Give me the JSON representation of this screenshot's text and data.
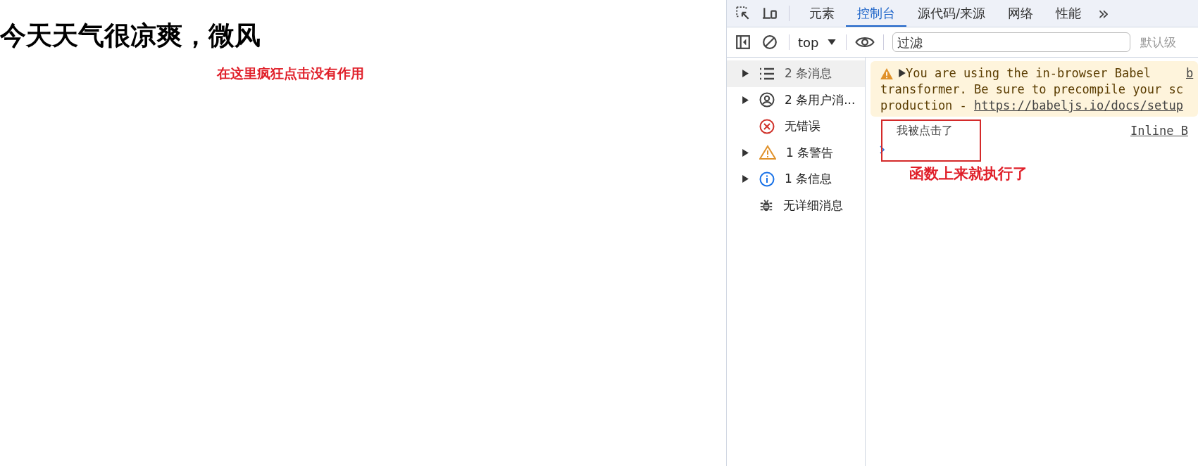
{
  "page": {
    "heading": "今天天气很凉爽，微风",
    "annotation": "在这里疯狂点击没有作用"
  },
  "devtools": {
    "tabs": [
      {
        "label": "元素",
        "selected": false
      },
      {
        "label": "控制台",
        "selected": true
      },
      {
        "label": "源代码/来源",
        "selected": false
      },
      {
        "label": "网络",
        "selected": false
      },
      {
        "label": "性能",
        "selected": false
      }
    ],
    "more": "»",
    "toolbar": {
      "context": "top",
      "filter": {
        "placeholder": "过滤"
      },
      "levels": "默认级"
    },
    "sidebar": {
      "items": [
        {
          "kind": "list",
          "label": "2 条消息",
          "expandable": true,
          "selected": true
        },
        {
          "kind": "user",
          "label": "2 条用户消...",
          "expandable": true,
          "selected": false
        },
        {
          "kind": "error",
          "label": "无错误",
          "expandable": false,
          "selected": false
        },
        {
          "kind": "warning",
          "label": "1 条警告",
          "expandable": true,
          "selected": false
        },
        {
          "kind": "info",
          "label": "1 条信息",
          "expandable": true,
          "selected": false
        },
        {
          "kind": "verbose",
          "label": "无详细消息",
          "expandable": false,
          "selected": false
        }
      ]
    },
    "console": {
      "messages": [
        {
          "kind": "warning",
          "lines": [
            "You are using the in-browser Babel",
            "transformer. Be sure to precompile your sc",
            "production - "
          ],
          "link": "https://babeljs.io/docs/setup",
          "source": "b"
        },
        {
          "kind": "log",
          "lines": [
            "我被点击了"
          ],
          "source": "Inline B"
        }
      ],
      "annotation": "函数上来就执行了"
    }
  }
}
